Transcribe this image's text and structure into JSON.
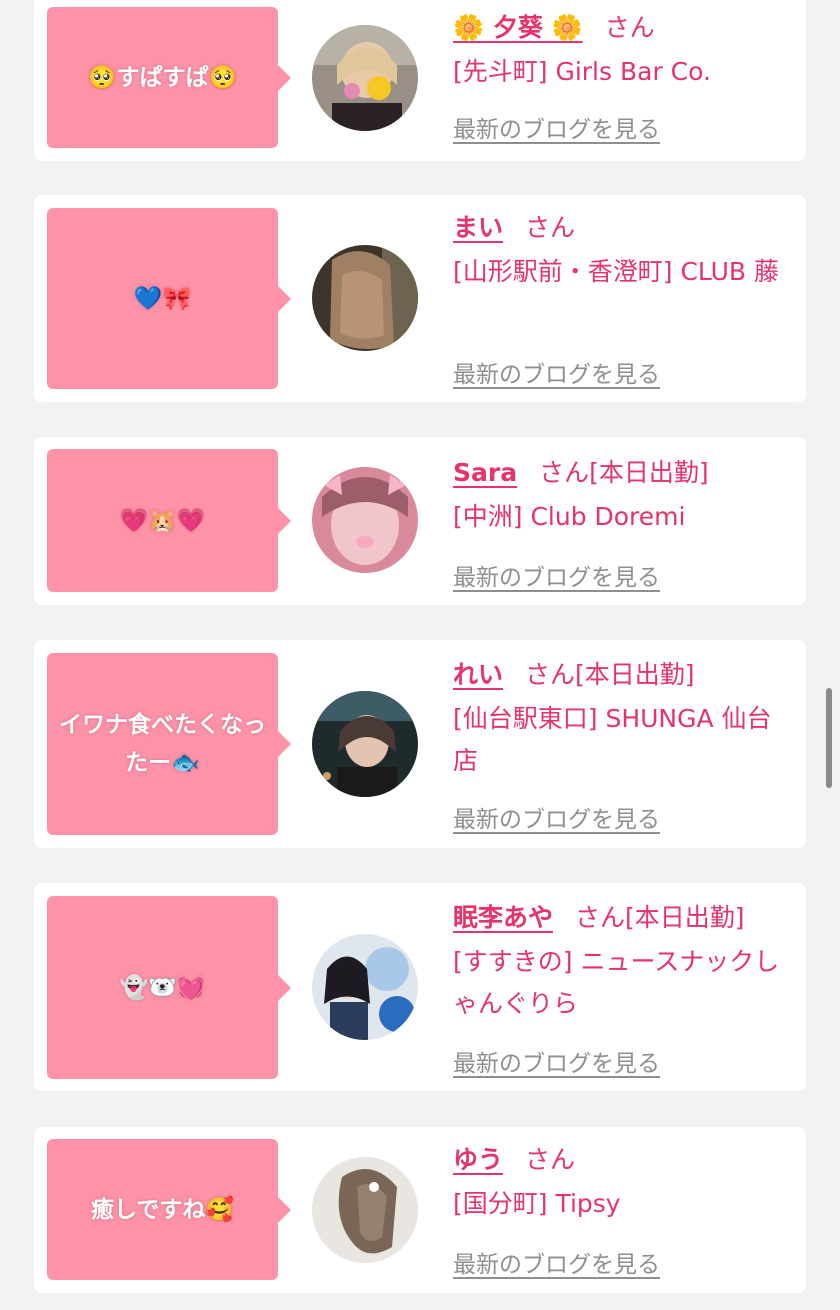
{
  "blog_link_label": "最新のブログを見る",
  "honorific": "さん",
  "entries": [
    {
      "comment": "🥺すぱすぱ🥺",
      "name": "🌼 夕葵 🌼",
      "status": "",
      "shop": "[先斗町] Girls Bar Co."
    },
    {
      "comment": "💙🎀",
      "name": "まい",
      "status": "",
      "shop": "[山形駅前・香澄町] CLUB 藤"
    },
    {
      "comment": "💗🐹💗",
      "name": "Sara",
      "status": "[本日出勤]",
      "shop": "[中洲] Club Doremi"
    },
    {
      "comment": "イワナ食べたくなったー🐟",
      "name": "れい",
      "status": "[本日出勤]",
      "shop": "[仙台駅東口] SHUNGA 仙台店"
    },
    {
      "comment": "👻🐻‍❄️💓",
      "name": "眠李あや",
      "status": "[本日出勤]",
      "shop": "[すすきの] ニュースナックしゃんぐりら"
    },
    {
      "comment": "癒しですね🥰",
      "name": "ゆう",
      "status": "",
      "shop": "[国分町] Tipsy"
    }
  ],
  "colors": {
    "accent": "#e8336a",
    "bubble": "#fe93a8",
    "link_gray": "#8f8f8f",
    "background": "#f2f2f2"
  }
}
